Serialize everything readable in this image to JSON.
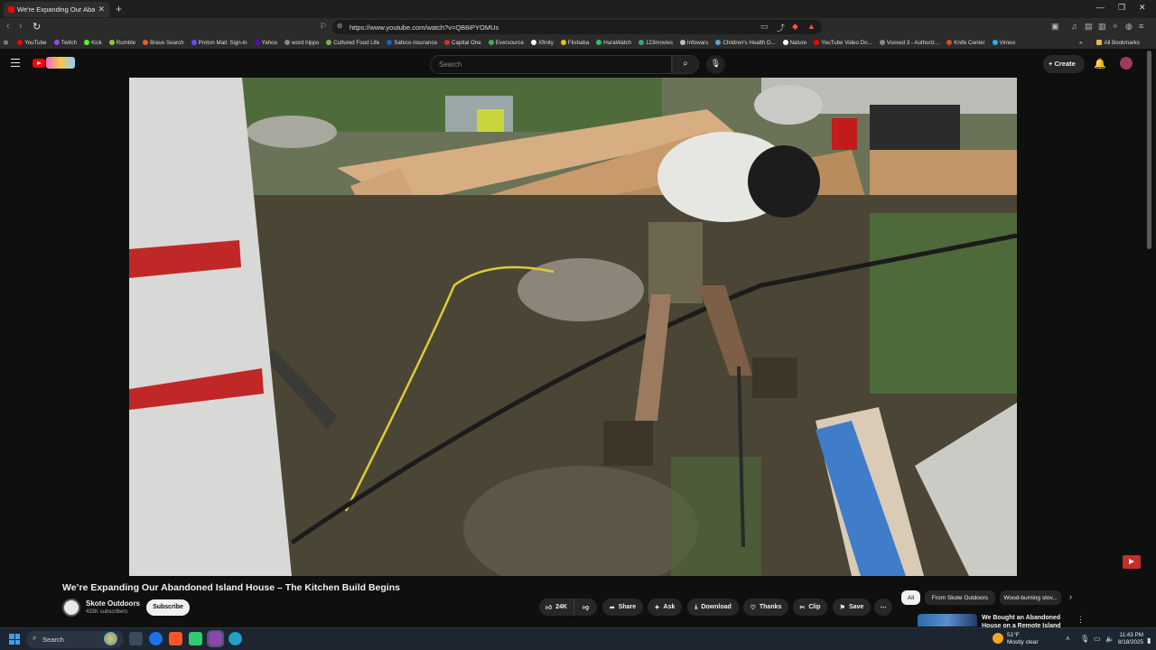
{
  "browser": {
    "tab_title": "We're Expanding Our Abandoned...",
    "url": "https://www.youtube.com/watch?v=QB8iPYOMUs",
    "bookmarks": [
      {
        "label": "YouTube",
        "color": "#ff0000"
      },
      {
        "label": "Twitch",
        "color": "#9146ff"
      },
      {
        "label": "Kick",
        "color": "#53fc18"
      },
      {
        "label": "Rumble",
        "color": "#85c742"
      },
      {
        "label": "Brave Search",
        "color": "#fb542b"
      },
      {
        "label": "Proton Mail: Sign-in",
        "color": "#6d4aff"
      },
      {
        "label": "Yahoo",
        "color": "#6001d2"
      },
      {
        "label": "word hippo",
        "color": "#888888"
      },
      {
        "label": "Cultured Food Life",
        "color": "#7fb05a"
      },
      {
        "label": "Safeco insurance",
        "color": "#1e5bc6"
      },
      {
        "label": "Capital One",
        "color": "#d03027"
      },
      {
        "label": "Eversource",
        "color": "#3ab54a"
      },
      {
        "label": "Xfinity",
        "color": "#ffffff"
      },
      {
        "label": "Flixbaba",
        "color": "#e6c300"
      },
      {
        "label": "HuraWatch",
        "color": "#2fbf71"
      },
      {
        "label": "123movies",
        "color": "#3aa76d"
      },
      {
        "label": "Infowars",
        "color": "#bbbbbb"
      },
      {
        "label": "Children's Health D...",
        "color": "#5aa0d0"
      },
      {
        "label": "Nature",
        "color": "#ffffff"
      },
      {
        "label": "YouTube Video Do...",
        "color": "#ff0000"
      },
      {
        "label": "Voxxed 3 - Authoriz...",
        "color": "#888888"
      },
      {
        "label": "Knife Center",
        "color": "#e04a2a"
      },
      {
        "label": "Vimeo",
        "color": "#1ab7ea"
      }
    ],
    "all_bookmarks": "All Bookmarks"
  },
  "header": {
    "search_placeholder": "Search",
    "create_label": "Create"
  },
  "video": {
    "title": "We’re Expanding Our Abandoned Island House – The Kitchen Build Begins",
    "channel": "Skote Outdoors",
    "subscribers": "433K subscribers",
    "subscribe_label": "Subscribe",
    "like_count": "24K",
    "actions": {
      "share": "Share",
      "ask": "Ask",
      "download": "Download",
      "thanks": "Thanks",
      "clip": "Clip",
      "save": "Save"
    }
  },
  "recommendations": {
    "chips": [
      "All",
      "From Skote Outdoors",
      "Wood-burning stov..."
    ],
    "first_title": "We Bought an Abandoned House on a Remote Island"
  },
  "taskbar": {
    "search_label": "Search",
    "weather_temp": "51°F",
    "weather_desc": "Mostly clear",
    "time": "11:43 PM",
    "date": "8/18/2025"
  }
}
